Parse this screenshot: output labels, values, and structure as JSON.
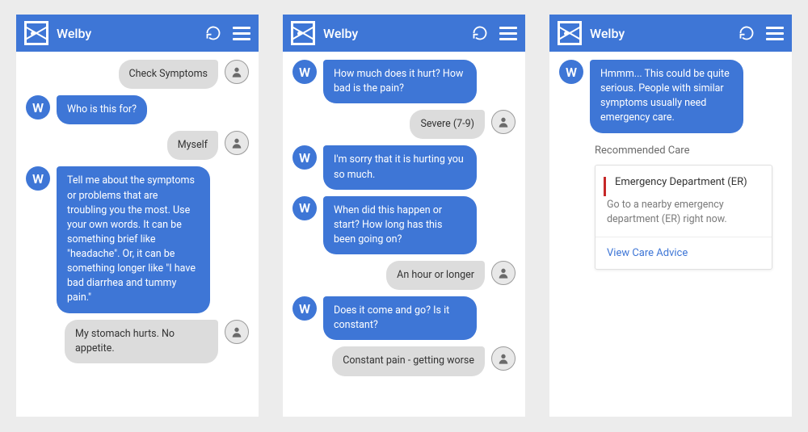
{
  "app_title": "Welby",
  "bot_avatar_letter": "W",
  "screens": [
    {
      "messages": [
        {
          "from": "user",
          "text": "Check Symptoms",
          "show_avatar": true
        },
        {
          "from": "bot",
          "text": "Who is this for?",
          "show_avatar": true
        },
        {
          "from": "user",
          "text": "Myself",
          "show_avatar": true
        },
        {
          "from": "bot",
          "text": "Tell me about the symptoms or problems that are troubling you the most. Use your own words. It can be something brief like \"headache\". Or, it can be something longer like \"I have bad diarrhea and tummy pain.\"",
          "show_avatar": true
        },
        {
          "from": "user",
          "text": "My stomach hurts. No appetite.",
          "show_avatar": true
        }
      ]
    },
    {
      "messages": [
        {
          "from": "bot",
          "text": "How much does it hurt? How bad is the pain?",
          "show_avatar": true
        },
        {
          "from": "user",
          "text": "Severe (7-9)",
          "show_avatar": true
        },
        {
          "from": "bot",
          "text": "I'm sorry that it is hurting you so much.",
          "show_avatar": true
        },
        {
          "from": "bot",
          "text": "When did this happen or start? How long has this been going on?",
          "show_avatar": true
        },
        {
          "from": "user",
          "text": "An hour or longer",
          "show_avatar": true
        },
        {
          "from": "bot",
          "text": "Does it come and go? Is it constant?",
          "show_avatar": true
        },
        {
          "from": "user",
          "text": "Constant pain - getting worse",
          "show_avatar": true
        }
      ]
    },
    {
      "messages": [
        {
          "from": "bot",
          "text": "Hmmm... This could be quite serious. People with similar symptoms usually need emergency care.",
          "show_avatar": true
        }
      ],
      "recommendation": {
        "section_title": "Recommended Care",
        "name": "Emergency Department (ER)",
        "desc": "Go to a nearby emergency department (ER) right now.",
        "link": "View Care Advice"
      }
    }
  ]
}
